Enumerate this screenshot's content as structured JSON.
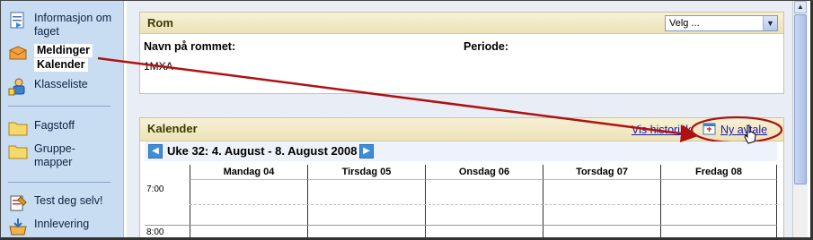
{
  "sidebar": {
    "items": [
      {
        "label": "Informasjon om faget",
        "icon": "info-page-icon"
      },
      {
        "label": "Meldinger",
        "icon": "messages-icon"
      },
      {
        "label": "Kalender",
        "icon": "calendar-icon"
      },
      {
        "label": "Klasseliste",
        "icon": "class-list-icon"
      },
      {
        "label": "Fagstoff",
        "icon": "folder-icon"
      },
      {
        "label": "Gruppe-mapper",
        "icon": "folder-icon"
      },
      {
        "label": "Test deg selv!",
        "icon": "test-icon"
      },
      {
        "label": "Innlevering",
        "icon": "submission-icon"
      }
    ]
  },
  "room": {
    "title": "Rom",
    "select_value": "Velg ...",
    "name_label": "Navn på rommet:",
    "name_value": "1MXA",
    "period_label": "Periode:"
  },
  "calendar": {
    "title": "Kalender",
    "history_link": "Vis historikk",
    "new_event_link": "Ny avtale",
    "week_title": "Uke 32: 4. August - 8. August 2008",
    "days": [
      "Mandag 04",
      "Tirsdag 05",
      "Onsdag 06",
      "Torsdag 07",
      "Fredag 08"
    ],
    "times": [
      "7:00",
      "8:00"
    ]
  },
  "colors": {
    "sidebar_bg": "#c9ddf2",
    "panel_head": "#ece2b8",
    "annotation_arrow": "#b01010",
    "link": "#1a1aa6"
  }
}
